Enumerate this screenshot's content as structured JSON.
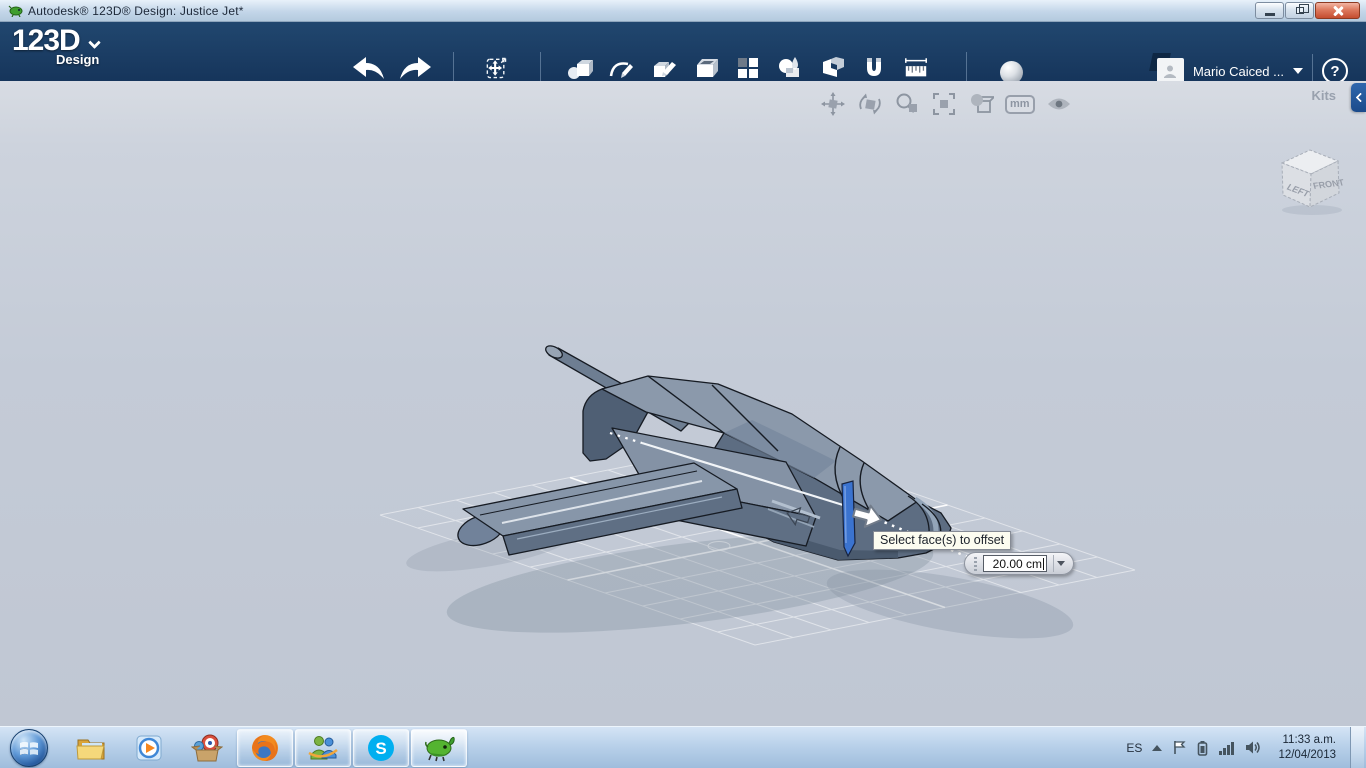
{
  "window": {
    "title": "Autodesk® 123D® Design: Justice Jet*"
  },
  "app_toolbar": {
    "logo_main": "123D",
    "logo_sub": "Design",
    "account_name": "Mario Caiced ...",
    "help_label": "?",
    "tools": [
      "transform",
      "primitives",
      "sketch",
      "construct",
      "modify",
      "pattern",
      "grouping",
      "combine",
      "snap",
      "measure"
    ]
  },
  "viewport": {
    "nav_units_label": "mm",
    "kits_label": "Kits",
    "viewcube": {
      "left_face": "LEFT",
      "front_face": "FRONT"
    },
    "tooltip": "Select face(s) to offset",
    "offset_value": "20.00 cm"
  },
  "taskbar": {
    "apps": [
      "start",
      "windows-explorer",
      "windows-media-player",
      "games-box",
      "firefox",
      "windows-live-messenger",
      "skype",
      "123d-design"
    ],
    "skype_letter": "S",
    "tray": {
      "language": "ES",
      "time": "11:33 a.m.",
      "date": "12/04/2013"
    }
  },
  "colors": {
    "toolbar_navy": "#1a3a62",
    "selection_blue": "#3b73cf",
    "viewport_bg": "#c5ccd8"
  }
}
